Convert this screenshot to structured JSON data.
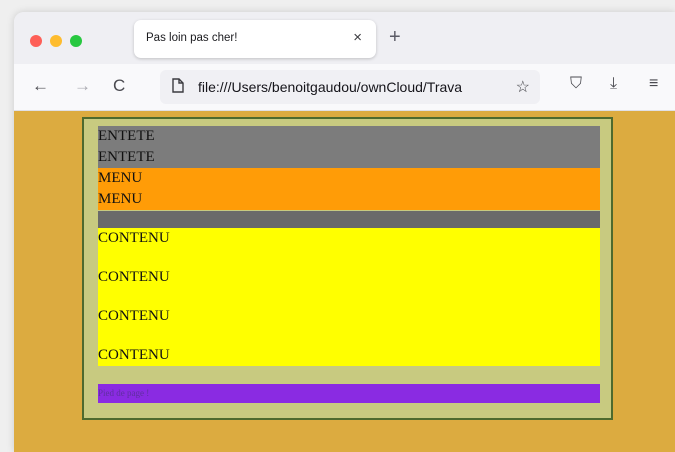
{
  "browser": {
    "tab_title": "Pas loin pas cher!",
    "tab_close": "×",
    "new_tab": "+",
    "back": "←",
    "forward": "→",
    "reload": "C",
    "url": "file:///Users/benoitgaudou/ownCloud/Trava",
    "page_icon": "page-icon",
    "star": "☆",
    "pocket": "⛉",
    "download": "⤓",
    "menu": "≡",
    "traffic_lights": {
      "close": "#fe5f57",
      "minimize": "#febc2e",
      "zoom": "#28c840"
    }
  },
  "page": {
    "entete": [
      "ENTETE",
      "ENTETE"
    ],
    "menu": [
      "MENU",
      "MENU"
    ],
    "contenu": [
      "CONTENU",
      "CONTENU",
      "CONTENU",
      "CONTENU"
    ],
    "footer": "Pied de page !"
  },
  "colors": {
    "background": "#dcab40",
    "frame": "#c8ca80",
    "entete": "#7c7c7c",
    "menu": "#ff9c07",
    "contenu": "#ffff00",
    "footer": "#8a2be2"
  }
}
